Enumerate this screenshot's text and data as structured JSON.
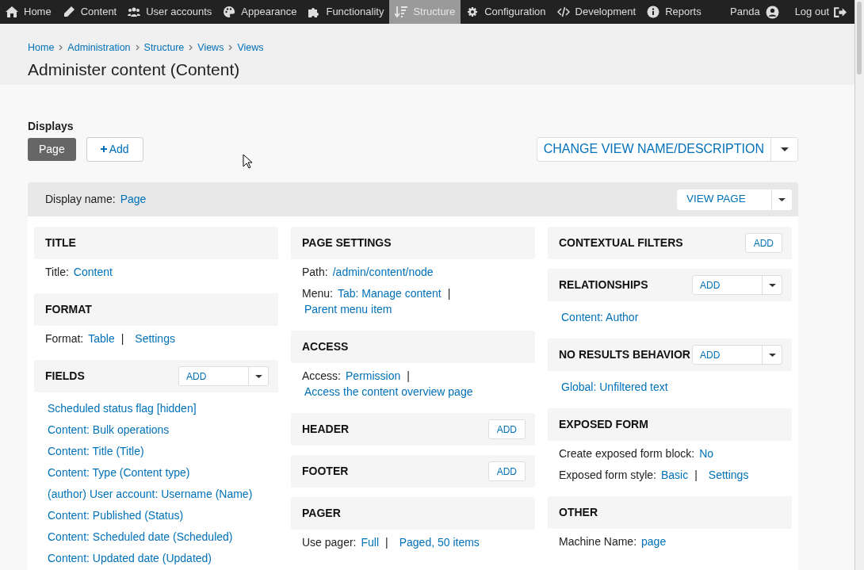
{
  "toolbar": {
    "items": [
      {
        "label": "Home",
        "kind": "home",
        "selected": false
      },
      {
        "label": "Content",
        "kind": "pencil",
        "selected": false
      },
      {
        "label": "User accounts",
        "kind": "users",
        "selected": false
      },
      {
        "label": "Appearance",
        "kind": "palette",
        "selected": false
      },
      {
        "label": "Functionality",
        "kind": "puzzle",
        "selected": false
      },
      {
        "label": "Structure",
        "kind": "sort",
        "selected": true
      },
      {
        "label": "Configuration",
        "kind": "gear",
        "selected": false
      },
      {
        "label": "Development",
        "kind": "code",
        "selected": false
      },
      {
        "label": "Reports",
        "kind": "info",
        "selected": false
      }
    ],
    "user": {
      "label": "Panda"
    },
    "logout": {
      "label": "Log out"
    }
  },
  "breadcrumbs": [
    "Home",
    "Administration",
    "Structure",
    "Views",
    "Views"
  ],
  "page_title": "Administer content (Content)",
  "displays": {
    "heading": "Displays",
    "tabs": [
      {
        "label": "Page",
        "selected": true
      }
    ],
    "add_button": "Add",
    "change_button": "CHANGE VIEW NAME/DESCRIPTION"
  },
  "display_bar": {
    "label": "Display name:",
    "value": "Page",
    "button": "VIEW PAGE"
  },
  "columns": [
    [
      {
        "title": "TITLE",
        "kind": "none",
        "lines": [
          [
            {
              "kind": "label",
              "text": "Title:"
            },
            {
              "kind": "link",
              "text": "Content"
            }
          ]
        ]
      },
      {
        "title": "FORMAT",
        "kind": "none",
        "lines": [
          [
            {
              "kind": "label",
              "text": "Format:"
            },
            {
              "kind": "link",
              "text": "Table"
            },
            {
              "kind": "separator",
              "text": "|"
            },
            {
              "kind": "link",
              "text": "Settings"
            }
          ]
        ]
      },
      {
        "title": "FIELDS",
        "kind": "dropdown",
        "add_label": "ADD",
        "lines": [
          [
            {
              "kind": "item",
              "text": "Scheduled status flag [hidden]"
            }
          ],
          [
            {
              "kind": "item",
              "text": "Content: Bulk operations"
            }
          ],
          [
            {
              "kind": "item",
              "text": "Content: Title (Title)"
            }
          ],
          [
            {
              "kind": "item",
              "text": "Content: Type (Content type)"
            }
          ],
          [
            {
              "kind": "item",
              "text": "(author) User account: Username (Name)"
            }
          ],
          [
            {
              "kind": "item",
              "text": "Content: Published (Status)"
            }
          ],
          [
            {
              "kind": "item",
              "text": "Content: Scheduled date (Scheduled)"
            }
          ],
          [
            {
              "kind": "item",
              "text": "Content: Updated date (Updated)"
            }
          ]
        ]
      }
    ],
    [
      {
        "title": "PAGE SETTINGS",
        "kind": "none",
        "lines": [
          [
            {
              "kind": "label",
              "text": "Path:"
            },
            {
              "kind": "link",
              "text": "/admin/content/node"
            }
          ],
          [
            {
              "kind": "label",
              "text": "Menu:"
            },
            {
              "kind": "link",
              "text": "Tab: Manage content"
            },
            {
              "kind": "separator",
              "text": "|"
            }
          ],
          [
            {
              "kind": "continued",
              "text": "Parent menu item"
            }
          ]
        ]
      },
      {
        "title": "ACCESS",
        "kind": "none",
        "lines": [
          [
            {
              "kind": "label",
              "text": "Access:"
            },
            {
              "kind": "link",
              "text": "Permission"
            },
            {
              "kind": "separator",
              "text": "|"
            }
          ],
          [
            {
              "kind": "continued",
              "text": "Access the content overview page"
            }
          ]
        ]
      },
      {
        "title": "HEADER",
        "kind": "button",
        "add_label": "ADD"
      },
      {
        "title": "FOOTER",
        "kind": "button",
        "add_label": "ADD"
      },
      {
        "title": "PAGER",
        "kind": "none",
        "lines": [
          [
            {
              "kind": "label",
              "text": "Use pager:"
            },
            {
              "kind": "link",
              "text": "Full"
            },
            {
              "kind": "separator",
              "text": "|"
            },
            {
              "kind": "link",
              "text": "Paged, 50 items"
            }
          ]
        ]
      }
    ],
    [
      {
        "title": "CONTEXTUAL FILTERS",
        "kind": "button",
        "add_label": "ADD"
      },
      {
        "title": "RELATIONSHIPS",
        "kind": "dropdown",
        "add_label": "ADD",
        "lines": [
          [
            {
              "kind": "item",
              "text": "Content: Author"
            }
          ]
        ]
      },
      {
        "title": "NO RESULTS BEHAVIOR",
        "kind": "dropdown",
        "add_label": "ADD",
        "lines": [
          [
            {
              "kind": "item",
              "text": "Global: Unfiltered text"
            }
          ]
        ]
      },
      {
        "title": "EXPOSED FORM",
        "kind": "none",
        "lines": [
          [
            {
              "kind": "label",
              "text": "Create exposed form block:"
            },
            {
              "kind": "link",
              "text": "No"
            }
          ],
          [
            {
              "kind": "label",
              "text": "Exposed form style:"
            },
            {
              "kind": "link",
              "text": "Basic"
            },
            {
              "kind": "separator",
              "text": "|"
            },
            {
              "kind": "link",
              "text": "Settings"
            }
          ]
        ]
      },
      {
        "title": "OTHER",
        "kind": "none",
        "lines": [
          [
            {
              "kind": "label",
              "text": "Machine Name:"
            },
            {
              "kind": "link",
              "text": "page"
            }
          ]
        ]
      }
    ]
  ]
}
